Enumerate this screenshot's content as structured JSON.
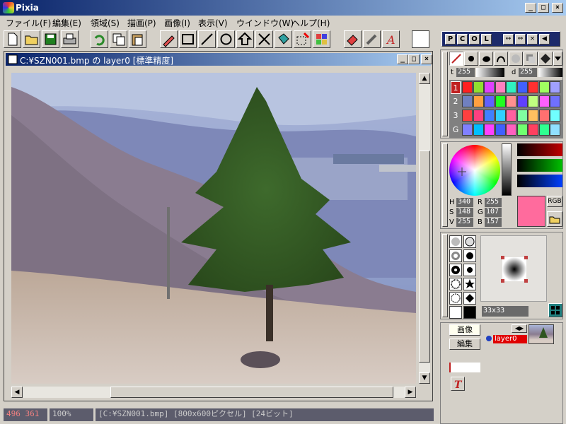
{
  "app": {
    "title": "Pixia",
    "minimize": "_",
    "maximize": "□",
    "close": "×"
  },
  "menu": [
    {
      "label": "ファイル(F)"
    },
    {
      "label": "編集(E)"
    },
    {
      "label": "領域(S)"
    },
    {
      "label": "描画(P)"
    },
    {
      "label": "画像(I)"
    },
    {
      "label": "表示(V)"
    },
    {
      "label": "ウインドウ(W)"
    },
    {
      "label": "ヘルプ(H)"
    }
  ],
  "document": {
    "title": "C:¥SZN001.bmp の layer0 [標準精度]"
  },
  "status": {
    "coords": "496 361",
    "zoom": "100%",
    "info": "[C:¥SZN001.bmp] [800x600ピクセル] [24ビット]"
  },
  "panel_top": {
    "btns": [
      "P",
      "C",
      "O",
      "L"
    ]
  },
  "pen": {
    "t_label": "t",
    "t_value": "255",
    "d_label": "d",
    "d_value": "255",
    "rows": [
      "1",
      "2",
      "3",
      "G"
    ]
  },
  "palette": {
    "rows": [
      [
        "#ff2020",
        "#90e030",
        "#e040ff",
        "#ff80c0",
        "#30f0c0",
        "#4060ff",
        "#ff3030",
        "#a0ff60",
        "#a0a0ff"
      ],
      [
        "#7080c0",
        "#ffa040",
        "#6060ff",
        "#20ff20",
        "#ff9090",
        "#6040ff",
        "#c0ff80",
        "#ff60ff",
        "#7070ff"
      ],
      [
        "#ff4040",
        "#ff4080",
        "#4080ff",
        "#30d0ff",
        "#ff60a0",
        "#80ffa0",
        "#ffc060",
        "#ff7070",
        "#70ffff"
      ],
      [
        "#8080ff",
        "#00c0ff",
        "#ff40ff",
        "#4060ff",
        "#ff60c0",
        "#70ff70",
        "#ff4060",
        "#30ff90",
        "#90e0ff"
      ]
    ]
  },
  "color": {
    "h_label": "H",
    "h": "340",
    "s_label": "S",
    "s": "148",
    "v_label": "V",
    "v": "255",
    "r_label": "R",
    "r": "255",
    "g_label": "G",
    "g": "107",
    "b_label": "B",
    "b": "157",
    "rgb_label": "RGB",
    "current": "#ff6b9d"
  },
  "brush": {
    "size": "33x33"
  },
  "layers": {
    "image_tab": "画像",
    "edit_tab": "編集",
    "layer_name": "layer0"
  }
}
